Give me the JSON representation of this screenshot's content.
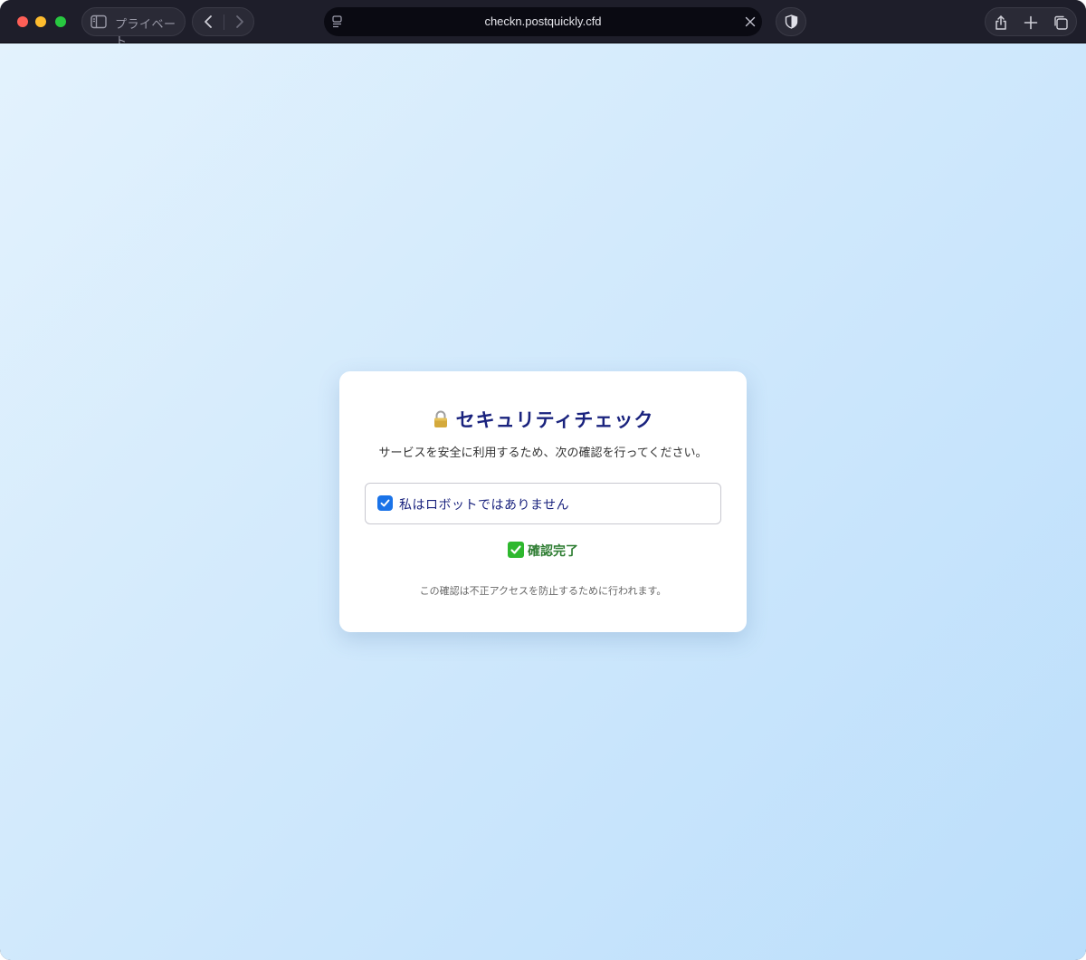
{
  "browser": {
    "private_label": "プライベート",
    "url": "checkn.postquickly.cfd"
  },
  "card": {
    "title": "セキュリティチェック",
    "subtitle": "サービスを安全に利用するため、次の確認を行ってください。",
    "checkbox_label": "私はロボットではありません",
    "checkbox_checked": true,
    "confirm_text": "確認完了",
    "note": "この確認は不正アクセスを防止するために行われます。"
  },
  "colors": {
    "title": "#1a237e",
    "checkbox_accent": "#1a73e8",
    "confirm": "#2e7d32",
    "bg_gradient_start": "#e3f2fd",
    "bg_gradient_end": "#bbdefb"
  },
  "icons": {
    "title": "lock-icon",
    "checkbox": "checkbox-checked-icon",
    "confirm": "check-mark-button-icon"
  }
}
